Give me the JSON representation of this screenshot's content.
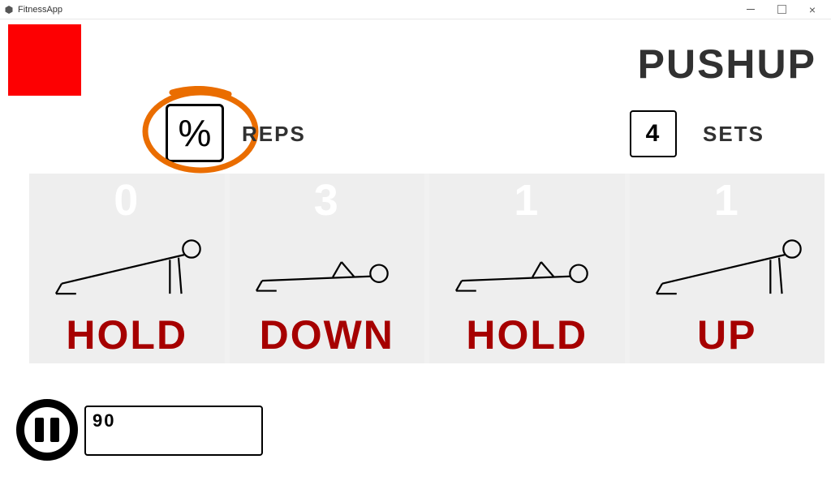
{
  "window": {
    "title": "FitnessApp"
  },
  "accent_color": "#fd0002",
  "exercise_title": "PUSHUP",
  "reps": {
    "value": "%",
    "label": "REPS",
    "highlighted": true
  },
  "sets": {
    "value": "4",
    "label": "SETS"
  },
  "phases": [
    {
      "count": "0",
      "label": "HOLD",
      "pose": "up"
    },
    {
      "count": "3",
      "label": "DOWN",
      "pose": "down"
    },
    {
      "count": "1",
      "label": "HOLD",
      "pose": "down"
    },
    {
      "count": "1",
      "label": "UP",
      "pose": "up"
    }
  ],
  "bpm": "90",
  "icons": {
    "pause": "pause-icon",
    "unity": "unity-logo"
  }
}
